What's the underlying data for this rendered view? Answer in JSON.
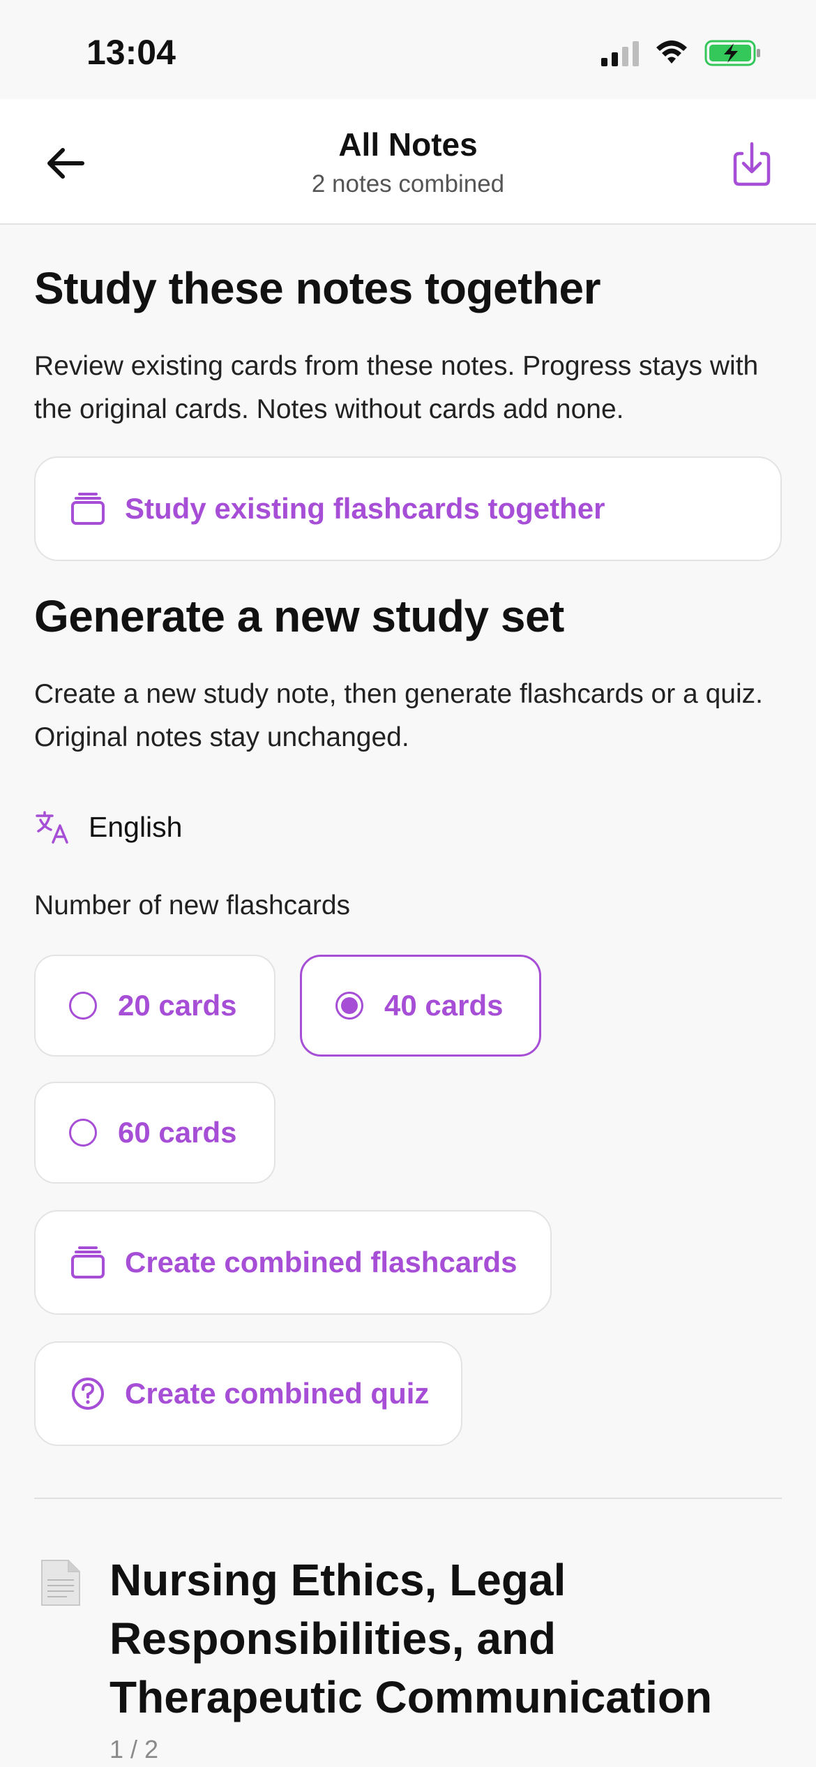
{
  "status": {
    "time": "13:04"
  },
  "header": {
    "title": "All Notes",
    "subtitle": "2 notes combined"
  },
  "study_section": {
    "title": "Study these notes together",
    "description": "Review existing cards from these notes. Progress stays with the original cards. Notes without cards add none.",
    "study_button_label": "Study existing flashcards together"
  },
  "generate_section": {
    "title": "Generate a new study set",
    "description": "Create a new study note, then generate flashcards or a quiz. Original notes stay unchanged.",
    "language": "English",
    "count_label": "Number of new flashcards",
    "options": [
      {
        "label": "20 cards",
        "selected": false
      },
      {
        "label": "40 cards",
        "selected": true
      },
      {
        "label": "60 cards",
        "selected": false
      }
    ],
    "create_flashcards_label": "Create combined flashcards",
    "create_quiz_label": "Create combined quiz"
  },
  "note": {
    "title": "Nursing Ethics, Legal Responsibilities, and Therapeutic Communication",
    "counter": "1 / 2"
  },
  "colors": {
    "accent": "#a64ed6",
    "battery": "#34c759"
  }
}
